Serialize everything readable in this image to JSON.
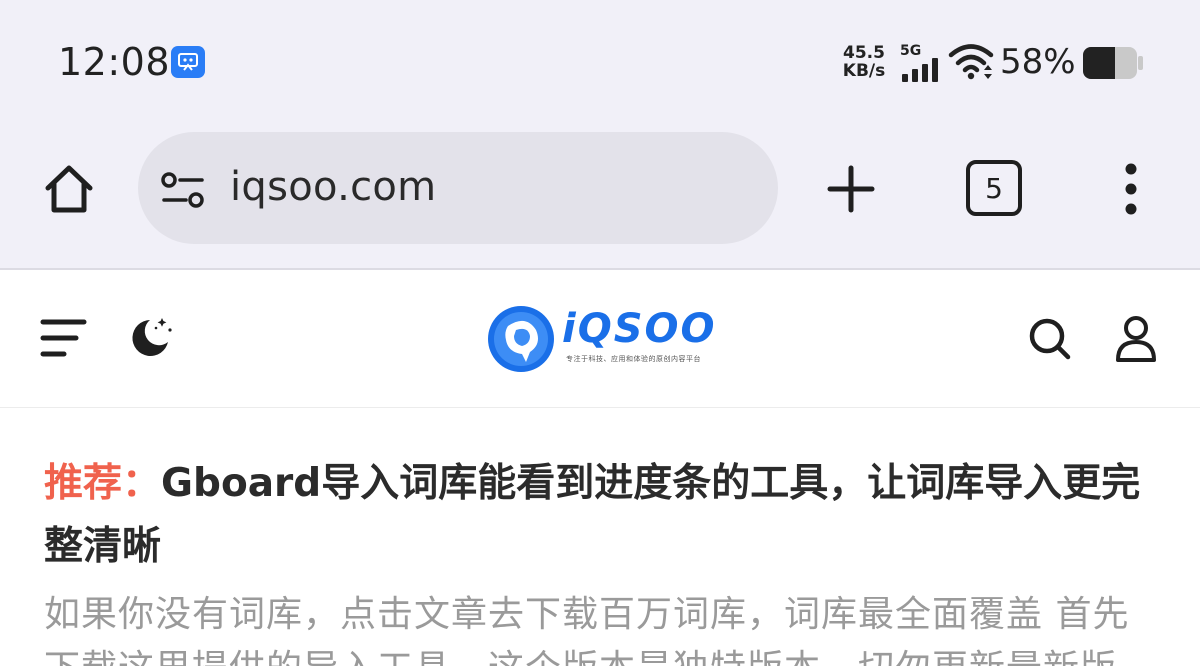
{
  "status_bar": {
    "time": "12:08",
    "net_speed_value": "45.5",
    "net_speed_unit": "KB/s",
    "network_type": "5G",
    "battery_percent": "58%",
    "battery_level": 0.58,
    "app_badge_icon": "screen-capture-icon"
  },
  "browser": {
    "url": "iqsoo.com",
    "tab_count": "5",
    "icons": [
      "home-icon",
      "tune-icon",
      "plus-icon",
      "tab-switcher-icon",
      "more-vert-icon"
    ]
  },
  "site_header": {
    "logo_text": "iQSOO",
    "logo_tagline": "专注于科技、应用和体验的原创内容平台",
    "icons": [
      "menu-icon",
      "dark-mode-icon",
      "search-icon",
      "user-icon"
    ],
    "brand_color": "#1a6fe8"
  },
  "article": {
    "label": "推荐：",
    "title": "Gboard导入词库能看到进度条的工具，让词库导入更完整清晰",
    "excerpt": "如果你没有词库，点击文章去下载百万词库，词库最全面覆盖 首先下载这里提供的导入工具，这个版本是独特版本，切勿更新最新版",
    "label_color": "#f0624d"
  }
}
